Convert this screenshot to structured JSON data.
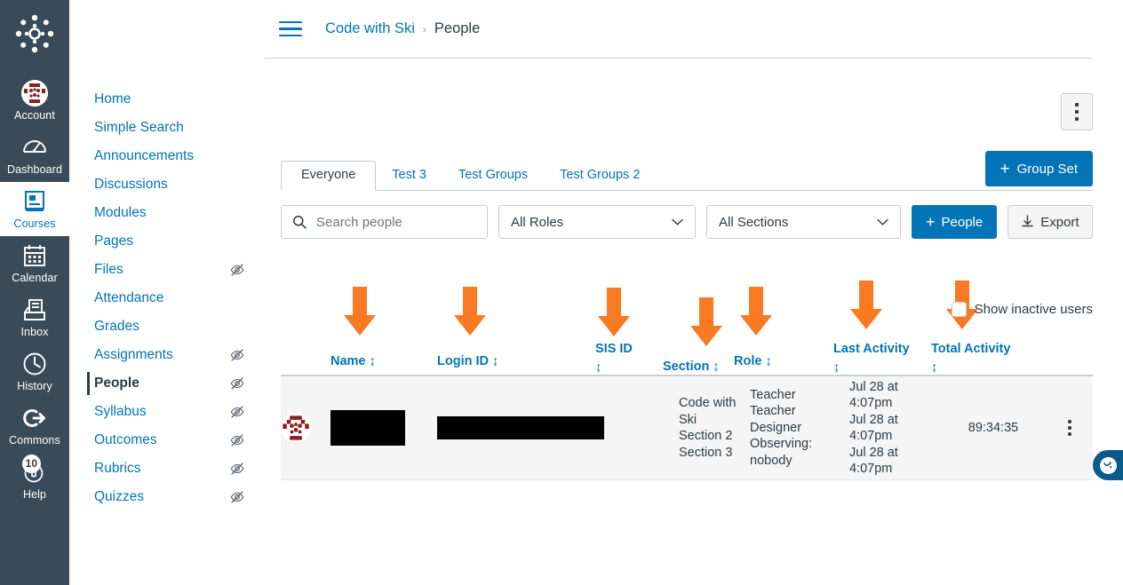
{
  "global_nav": {
    "logo_name": "canvas-logo",
    "items": [
      {
        "label": "Account",
        "icon": "avatar-identicon-icon",
        "active": false,
        "badge": null
      },
      {
        "label": "Dashboard",
        "icon": "dashboard-speedometer-icon",
        "active": false,
        "badge": null
      },
      {
        "label": "Courses",
        "icon": "courses-book-icon",
        "active": true,
        "badge": null
      },
      {
        "label": "Calendar",
        "icon": "calendar-icon",
        "active": false,
        "badge": null
      },
      {
        "label": "Inbox",
        "icon": "inbox-tray-icon",
        "active": false,
        "badge": null
      },
      {
        "label": "History",
        "icon": "history-clock-icon",
        "active": false,
        "badge": null
      },
      {
        "label": "Commons",
        "icon": "commons-arrow-icon",
        "active": false,
        "badge": null
      },
      {
        "label": "Help",
        "icon": "help-lifepreserver-icon",
        "active": false,
        "badge": "10"
      }
    ]
  },
  "course_nav": {
    "items": [
      {
        "label": "Home",
        "hidden_icon": false,
        "active": false
      },
      {
        "label": "Simple Search",
        "hidden_icon": false,
        "active": false
      },
      {
        "label": "Announcements",
        "hidden_icon": false,
        "active": false
      },
      {
        "label": "Discussions",
        "hidden_icon": false,
        "active": false
      },
      {
        "label": "Modules",
        "hidden_icon": false,
        "active": false
      },
      {
        "label": "Pages",
        "hidden_icon": false,
        "active": false
      },
      {
        "label": "Files",
        "hidden_icon": true,
        "active": false
      },
      {
        "label": "Attendance",
        "hidden_icon": false,
        "active": false
      },
      {
        "label": "Grades",
        "hidden_icon": false,
        "active": false
      },
      {
        "label": "Assignments",
        "hidden_icon": true,
        "active": false
      },
      {
        "label": "People",
        "hidden_icon": true,
        "active": true
      },
      {
        "label": "Syllabus",
        "hidden_icon": true,
        "active": false
      },
      {
        "label": "Outcomes",
        "hidden_icon": true,
        "active": false
      },
      {
        "label": "Rubrics",
        "hidden_icon": true,
        "active": false
      },
      {
        "label": "Quizzes",
        "hidden_icon": true,
        "active": false
      }
    ]
  },
  "breadcrumb": {
    "menu_icon": "hamburger-menu-icon",
    "course": "Code with Ski",
    "separator": "›",
    "current": "People"
  },
  "tabs": [
    {
      "label": "Everyone",
      "active": true
    },
    {
      "label": "Test 3",
      "active": false
    },
    {
      "label": "Test Groups",
      "active": false
    },
    {
      "label": "Test Groups 2",
      "active": false
    }
  ],
  "actions": {
    "group_set_label": "Group Set",
    "group_set_plus": "+",
    "kebab_name": "more-options"
  },
  "toolbar": {
    "search_placeholder": "Search people",
    "search_value": "",
    "roles_value": "All Roles",
    "sections_value": "All Sections",
    "people_label": "People",
    "people_plus": "+",
    "export_label": "Export"
  },
  "table": {
    "sort_icon": "↨",
    "columns": [
      {
        "key": "name",
        "label": "Name",
        "sortable": true,
        "annotated": true
      },
      {
        "key": "login",
        "label": "Login ID",
        "sortable": true,
        "annotated": true
      },
      {
        "key": "sis",
        "label": "SIS ID",
        "sortable": true,
        "annotated": true
      },
      {
        "key": "section",
        "label": "Section",
        "sortable": true,
        "annotated": true
      },
      {
        "key": "role",
        "label": "Role",
        "sortable": true,
        "annotated": true
      },
      {
        "key": "last_activity",
        "label": "Last Activity",
        "sortable": true,
        "annotated": true
      },
      {
        "key": "total_activity",
        "label": "Total Activity",
        "sortable": true,
        "annotated": true
      }
    ],
    "show_inactive": {
      "label": "Show inactive users",
      "checked": false
    },
    "rows": [
      {
        "avatar": "identicon-avatar",
        "name_redacted": true,
        "login_redacted": true,
        "sis_id": "",
        "section": "Code with Ski\nSection 2\nSection 3",
        "role": "Teacher\nTeacher\nDesigner\nObserving: nobody",
        "last_activity": "Jul 28 at 4:07pm\nJul 28 at 4:07pm\nJul 28 at 4:07pm",
        "total_activity": "89:34:35",
        "menu_icon": "row-more-options-icon"
      }
    ]
  },
  "chat_widget": {
    "icon": "chat-bubble-icon"
  },
  "colors": {
    "brand_blue": "#0374B5",
    "nav_dark": "#394B58",
    "text_dark": "#2D3B45",
    "border": "#C7CDD1",
    "row_bg": "#F5F5F5",
    "annotation_orange": "#FA7A23",
    "identicon_red": "#8B2020"
  }
}
